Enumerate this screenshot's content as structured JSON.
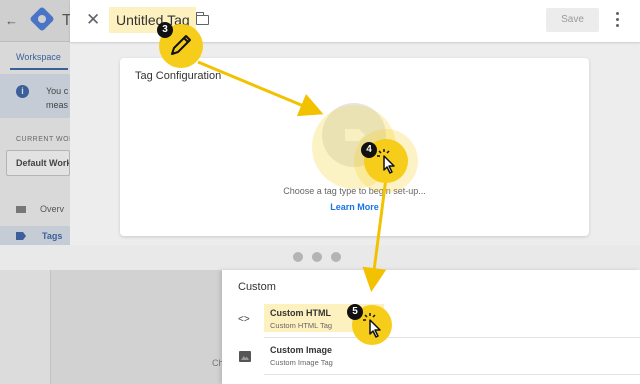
{
  "background_app": {
    "back_arrow": "←",
    "app_letter": "T",
    "workspace_tab": "Workspace",
    "info_lines": [
      "You c",
      "meas"
    ],
    "current_workspace_label": "CURRENT WORK",
    "workspace_name": "Default Work",
    "nav_items": [
      "Overv",
      "Tags"
    ]
  },
  "editor": {
    "close_icon": "✕",
    "tag_name": "Untitled Tag",
    "save_label": "Save",
    "more_icon": "more-vert"
  },
  "tag_configuration": {
    "title": "Tag Configuration",
    "prompt": "Choose a tag type to begin set-up...",
    "learn_more": "Learn More"
  },
  "picker": {
    "heading": "Custom",
    "items": [
      {
        "icon": "<>",
        "title": "Custom HTML",
        "subtitle": "Custom HTML Tag"
      },
      {
        "icon": "image-icon",
        "title": "Custom Image",
        "subtitle": "Custom Image Tag"
      }
    ]
  },
  "lower_left": {
    "fragment": "Ch"
  },
  "annotations": {
    "steps": [
      "3",
      "4",
      "5"
    ],
    "accent_color": "#f7cd1b"
  }
}
